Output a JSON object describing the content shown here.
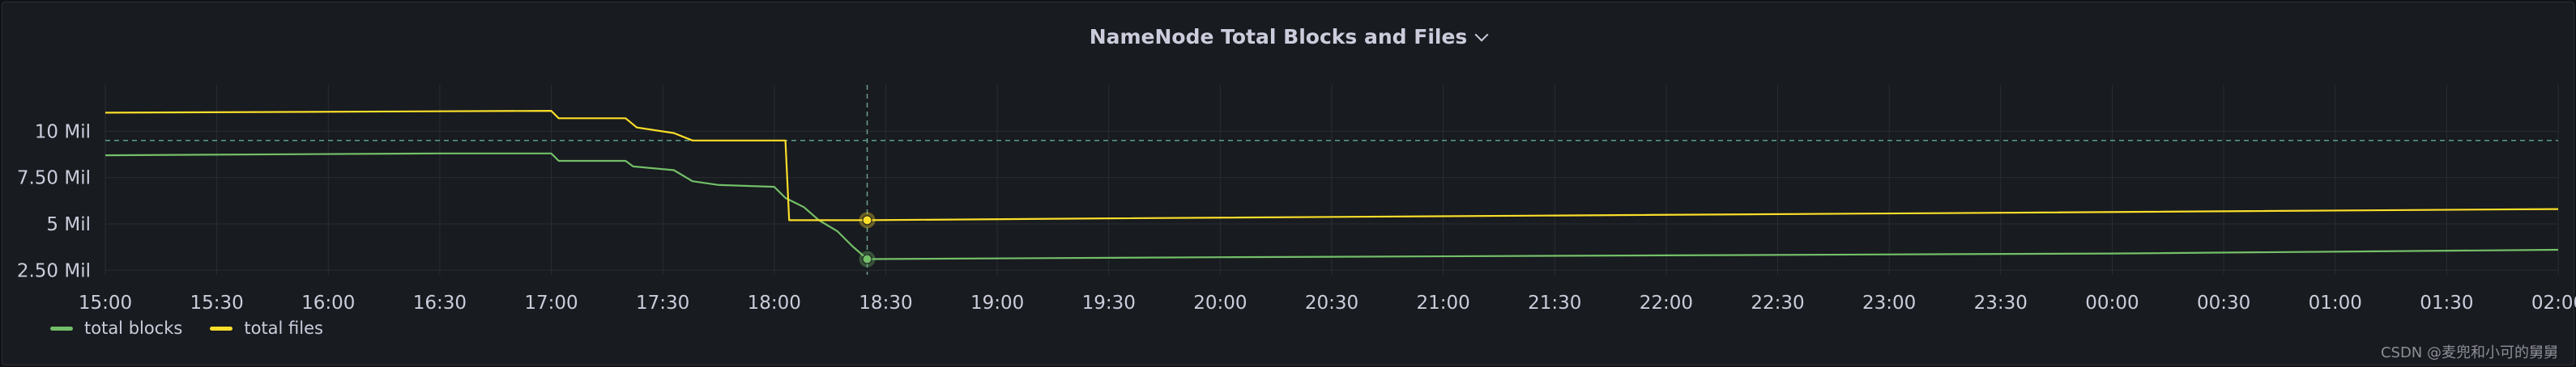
{
  "panel": {
    "title": "NameNode Total Blocks and Files"
  },
  "legend": {
    "items": [
      {
        "label": "total blocks",
        "color": "#73bf69"
      },
      {
        "label": "total files",
        "color": "#fade2a"
      }
    ]
  },
  "watermark": "CSDN @麦兜和小可的舅舅",
  "chart_data": {
    "type": "line",
    "title": "NameNode Total Blocks and Files",
    "xlabel": "",
    "ylabel": "",
    "ylim": [
      2.25,
      12.5
    ],
    "y_unit": "Mil",
    "y_ticks": [
      {
        "value": 2.5,
        "label": "2.50 Mil"
      },
      {
        "value": 5,
        "label": "5 Mil"
      },
      {
        "value": 7.5,
        "label": "7.50 Mil"
      },
      {
        "value": 10,
        "label": "10 Mil"
      }
    ],
    "x_ticks": [
      "15:00",
      "15:30",
      "16:00",
      "16:30",
      "17:00",
      "17:30",
      "18:00",
      "18:30",
      "19:00",
      "19:30",
      "20:00",
      "20:30",
      "21:00",
      "21:30",
      "22:00",
      "22:30",
      "23:00",
      "23:30",
      "00:00",
      "00:30",
      "01:00",
      "01:30",
      "02:00"
    ],
    "grid": true,
    "legend_position": "bottom-left",
    "hover_time": "18:25",
    "threshold": 9.5,
    "series": [
      {
        "name": "total blocks",
        "color": "#73bf69",
        "points": [
          [
            "15:00",
            8.7
          ],
          [
            "16:30",
            8.8
          ],
          [
            "17:00",
            8.8
          ],
          [
            "17:02",
            8.4
          ],
          [
            "17:20",
            8.4
          ],
          [
            "17:22",
            8.1
          ],
          [
            "17:33",
            7.9
          ],
          [
            "17:38",
            7.3
          ],
          [
            "17:45",
            7.1
          ],
          [
            "18:00",
            7.0
          ],
          [
            "18:03",
            6.4
          ],
          [
            "18:08",
            5.9
          ],
          [
            "18:12",
            5.2
          ],
          [
            "18:17",
            4.6
          ],
          [
            "18:21",
            3.8
          ],
          [
            "18:25",
            3.1
          ],
          [
            "20:00",
            3.2
          ],
          [
            "22:00",
            3.3
          ],
          [
            "00:00",
            3.4
          ],
          [
            "02:00",
            3.6
          ]
        ]
      },
      {
        "name": "total files",
        "color": "#fade2a",
        "points": [
          [
            "15:00",
            11.0
          ],
          [
            "17:00",
            11.1
          ],
          [
            "17:02",
            10.7
          ],
          [
            "17:20",
            10.7
          ],
          [
            "17:23",
            10.2
          ],
          [
            "17:33",
            9.9
          ],
          [
            "17:38",
            9.5
          ],
          [
            "18:03",
            9.5
          ],
          [
            "18:04",
            5.2
          ],
          [
            "18:25",
            5.2
          ],
          [
            "19:30",
            5.3
          ],
          [
            "21:30",
            5.45
          ],
          [
            "23:30",
            5.6
          ],
          [
            "02:00",
            5.8
          ]
        ]
      }
    ]
  }
}
